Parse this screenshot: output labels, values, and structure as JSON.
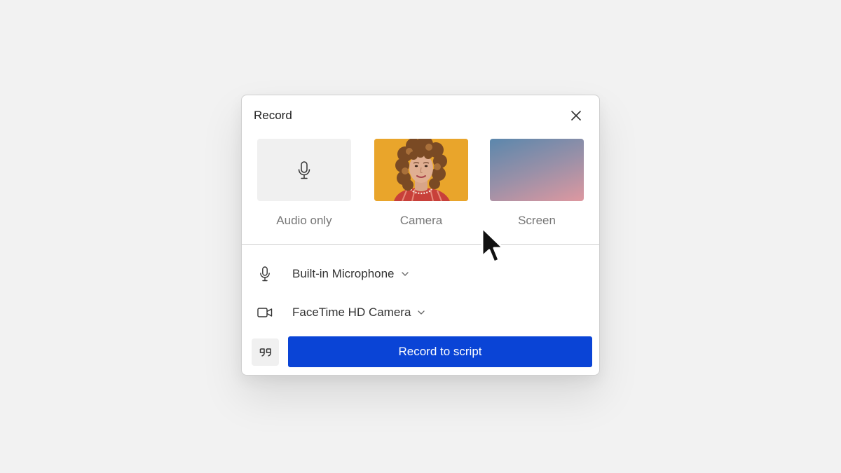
{
  "dialog": {
    "title": "Record",
    "close_icon": "close-icon"
  },
  "options": [
    {
      "label": "Audio only",
      "icon": "microphone-icon"
    },
    {
      "label": "Camera"
    },
    {
      "label": "Screen"
    }
  ],
  "devices": {
    "microphone": {
      "label": "Built-in Microphone",
      "icon": "microphone-icon"
    },
    "camera": {
      "label": "FaceTime HD Camera",
      "icon": "video-camera-icon"
    }
  },
  "actions": {
    "quote_icon": "quote-icon",
    "record_label": "Record to script"
  },
  "colors": {
    "accent": "#0a44d6",
    "background": "#f2f2f2"
  }
}
